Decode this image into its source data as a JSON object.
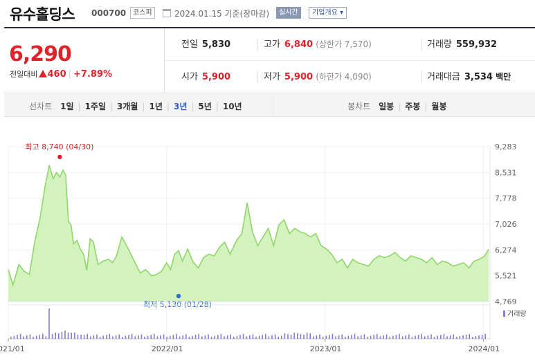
{
  "header": {
    "company_name": "유수홀딩스",
    "stock_code": "000700",
    "market": "코스피",
    "date_text": "2024.01.15 기준(장마감)",
    "realtime_label": "실시간",
    "overview_label": "기업개요 ▾"
  },
  "summary": {
    "current_price": "6,290",
    "change_label": "전일대비",
    "change_amount": "460",
    "change_percent": "+7.89%",
    "prev_close_label": "전일",
    "prev_close": "5,830",
    "high_label": "고가",
    "high": "6,840",
    "upper_limit": "(상한가 7,570)",
    "volume_label": "거래량",
    "volume": "559,932",
    "open_label": "시가",
    "open": "5,900",
    "low_label": "저가",
    "low": "5,900",
    "lower_limit": "(하한가 4,090)",
    "value_label": "거래대금",
    "value": "3,534",
    "value_unit": "백만"
  },
  "period": {
    "line_label": "선차트",
    "line_options": [
      "1일",
      "1주일",
      "3개월",
      "1년",
      "3년",
      "5년",
      "10년"
    ],
    "active": "3년",
    "candle_label": "봉차트",
    "candle_options": [
      "일봉",
      "주봉",
      "월봉"
    ]
  },
  "colors": {
    "up": "#e0232b",
    "down": "#2a6ed1",
    "line": "#8fd66a",
    "fill": "#d4f2bd",
    "volume": "#8a78d8"
  },
  "chart_data": {
    "type": "area",
    "y_ticks": [
      "9,283",
      "8,531",
      "7,778",
      "7,026",
      "6,274",
      "5,521",
      "4,769"
    ],
    "ylim": [
      4769,
      9283
    ],
    "x_ticks": [
      "2021/01",
      "2022/01",
      "2023/01",
      "2024/01"
    ],
    "xlim": [
      0,
      36.5
    ],
    "high_annotation": "최고 8,740 (04/30)",
    "low_annotation": "최저 5,130 (01/28)",
    "high_point": {
      "x": 3.9,
      "y": 8740
    },
    "low_point": {
      "x": 12.9,
      "y": 5130
    },
    "volume_label": "거래량",
    "series": [
      {
        "x": [
          0,
          0.35,
          0.8,
          1.2,
          1.6,
          2.0,
          2.4,
          2.8,
          3.1,
          3.4,
          3.65,
          3.9,
          4.15,
          4.35,
          4.55,
          4.75,
          4.95,
          5.2,
          5.45,
          5.7,
          5.95,
          6.2,
          6.45,
          6.8,
          7.2,
          7.6,
          7.9,
          8.2,
          8.6,
          9.1,
          9.6,
          10.0,
          10.4,
          10.85,
          11.2,
          11.6,
          12.0,
          12.3,
          12.6,
          12.9,
          13.2,
          13.6,
          14.0,
          14.4,
          14.8,
          15.2,
          15.6,
          16.0,
          16.4,
          16.8,
          17.3,
          17.7,
          18.1,
          18.5,
          18.9,
          19.3,
          19.7,
          20.1,
          20.5,
          20.9,
          21.3,
          21.7,
          22.1,
          22.5,
          22.9,
          23.3,
          23.7,
          24.1,
          24.5,
          24.9,
          25.3,
          25.7,
          26.1,
          26.5,
          26.9,
          27.3,
          27.7,
          28.1,
          28.5,
          28.9,
          29.3,
          29.7,
          30.1,
          30.5,
          30.9,
          31.3,
          31.7,
          32.1,
          32.5,
          32.9,
          33.3,
          33.7,
          34.1,
          34.5,
          34.9,
          35.3,
          35.7,
          36.1,
          36.4
        ],
        "values": [
          5700,
          5250,
          5850,
          5650,
          5560,
          6500,
          7200,
          8150,
          8740,
          8350,
          8530,
          8400,
          8600,
          8450,
          7100,
          7000,
          6450,
          6550,
          6300,
          6150,
          5680,
          6600,
          6500,
          5850,
          5950,
          6000,
          5900,
          6100,
          6650,
          6300,
          5900,
          5600,
          5700,
          5520,
          5550,
          5650,
          5900,
          5700,
          6150,
          6250,
          5950,
          6300,
          5920,
          5750,
          6050,
          6150,
          6100,
          6350,
          6500,
          6150,
          6550,
          6750,
          7650,
          6800,
          6400,
          6650,
          6900,
          6400,
          7000,
          7150,
          6750,
          6900,
          6800,
          6750,
          6650,
          6750,
          6400,
          6300,
          6150,
          5900,
          6000,
          5750,
          6000,
          5900,
          5850,
          5800,
          6000,
          6100,
          6050,
          6100,
          6200,
          6050,
          5950,
          6100,
          6050,
          6000,
          5900,
          6050,
          5850,
          5950,
          5900,
          5800,
          5850,
          5900,
          5750,
          5950,
          6000,
          6100,
          6290
        ]
      }
    ]
  }
}
